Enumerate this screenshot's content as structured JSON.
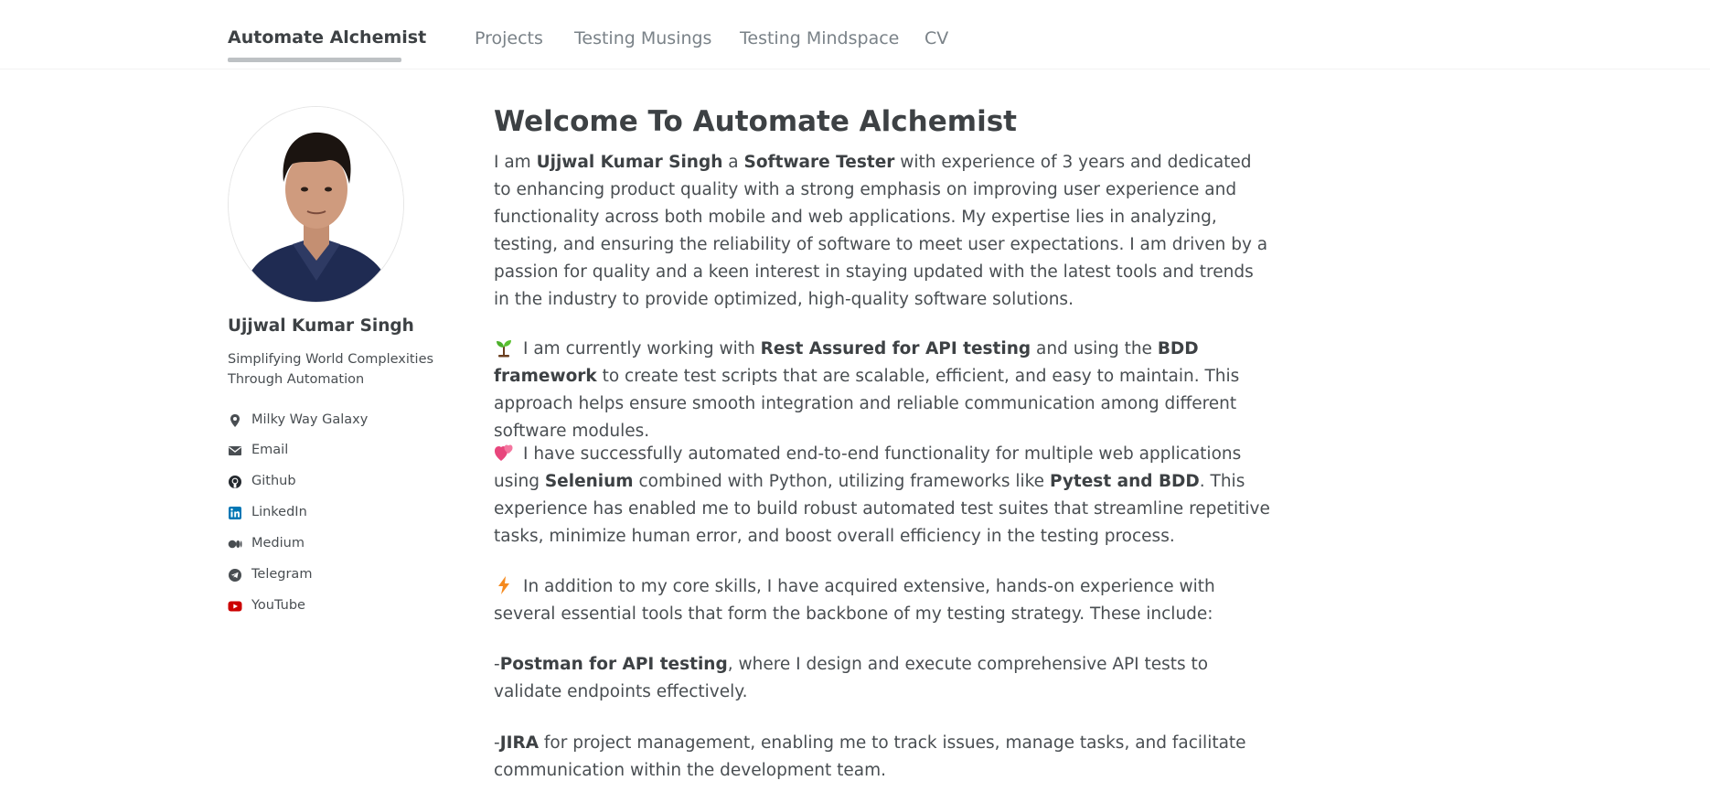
{
  "header": {
    "brand": "Automate Alchemist",
    "nav": [
      "Projects",
      "Testing Musings",
      "Testing Mindspace",
      "CV"
    ]
  },
  "author": {
    "name": "Ujjwal Kumar Singh",
    "bio": "Simplifying World Complexities Through Automation",
    "links": [
      {
        "label": "Milky Way Galaxy",
        "icon": "map-marker-icon"
      },
      {
        "label": "Email",
        "icon": "envelope-icon"
      },
      {
        "label": "Github",
        "icon": "github-icon"
      },
      {
        "label": "LinkedIn",
        "icon": "linkedin-icon",
        "color": "#0077b5"
      },
      {
        "label": "Medium",
        "icon": "medium-icon"
      },
      {
        "label": "Telegram",
        "icon": "telegram-icon"
      },
      {
        "label": "YouTube",
        "icon": "youtube-icon",
        "color": "#cc0000"
      }
    ]
  },
  "main": {
    "title": "Welcome To Automate Alchemist",
    "p1": {
      "t1": "I am ",
      "b1": "Ujjwal Kumar Singh",
      "t2": " a ",
      "b2": "Software Tester",
      "t3": " with experience of 3 years and dedicated to enhancing product quality with a strong emphasis on improving user experience and functionality across both mobile and web applications. My expertise lies in analyzing, testing, and ensuring the reliability of software to meet user expectations. I am driven by a passion for quality and a keen interest in staying updated with the latest tools and trends in the industry to provide optimized, high-quality software solutions."
    },
    "p2": {
      "emoji": "seedling-icon",
      "t1": "I am currently working with ",
      "b1": "Rest Assured for API testing",
      "t2": " and using the ",
      "b2": "BDD framework",
      "t3": " to create test scripts that are scalable, efficient, and easy to maintain. This approach helps ensure smooth integration and reliable communication among different software modules."
    },
    "p3": {
      "emoji": "two-hearts-icon",
      "t1": "I have successfully automated end-to-end functionality for multiple web applications using ",
      "b1": "Selenium",
      "t2": " combined with Python, utilizing frameworks like ",
      "b2": "Pytest and BDD",
      "t3": ". This experience has enabled me to build robust automated test suites that streamline repetitive tasks, minimize human error, and boost overall efficiency in the testing process."
    },
    "p4": {
      "emoji": "zap-icon",
      "t1": "In addition to my core skills, I have acquired extensive, hands-on experience with several essential tools that form the backbone of my testing strategy. These include:"
    },
    "p5": {
      "t1": "-",
      "b1": "Postman for API testing",
      "t2": ", where I design and execute comprehensive API tests to validate endpoints effectively."
    },
    "p6": {
      "t1": "-",
      "b1": "JIRA",
      "t2": " for project management, enabling me to track issues, manage tasks, and facilitate communication within the development team."
    }
  }
}
